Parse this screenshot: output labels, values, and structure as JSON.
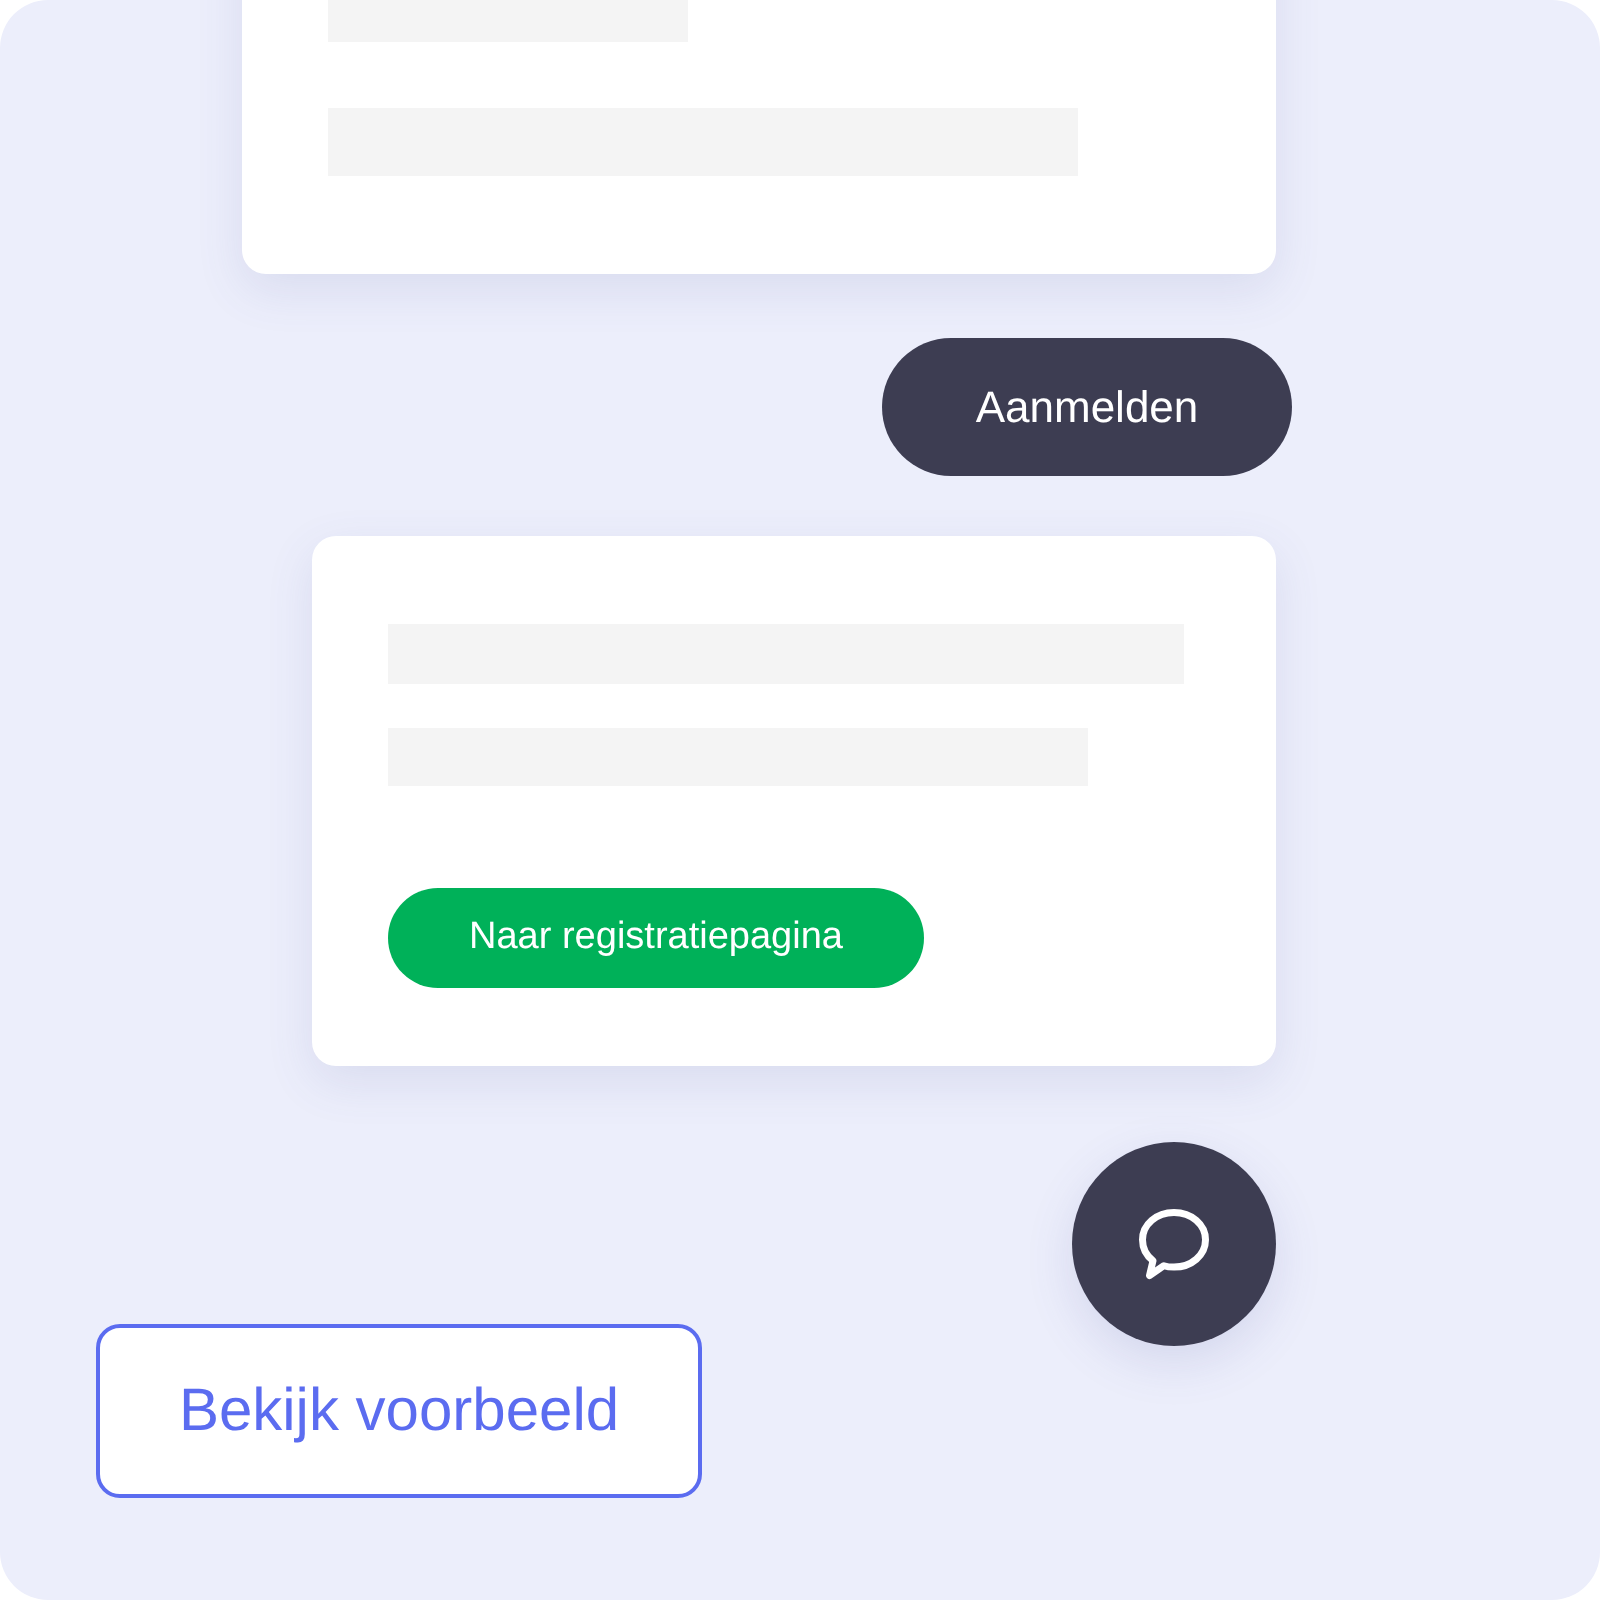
{
  "login_button": {
    "label": "Aanmelden"
  },
  "registration_card": {
    "button": {
      "label": "Naar registratiepagina"
    }
  },
  "preview_button": {
    "label": "Bekijk voorbeeld"
  }
}
